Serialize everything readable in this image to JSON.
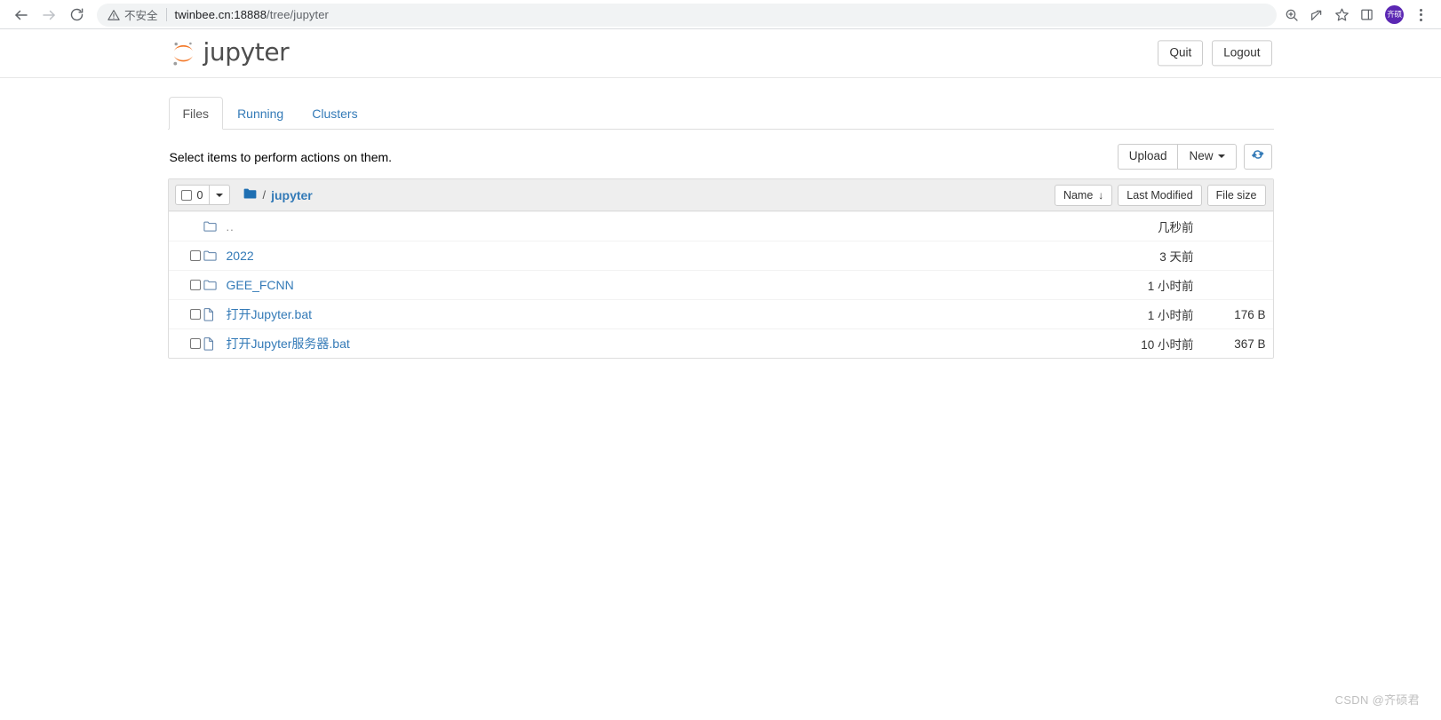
{
  "browser": {
    "back_icon": "back-arrow-icon",
    "forward_icon": "forward-arrow-icon",
    "reload_icon": "reload-icon",
    "security_label": "不安全",
    "url_host": "twinbee.cn:18888",
    "url_path": "/tree/jupyter",
    "zoom_icon": "zoom-in-icon",
    "share_icon": "share-icon",
    "bookmark_icon": "star-icon",
    "sidepanel_icon": "side-panel-icon",
    "avatar_initials": "齐硕",
    "menu_icon": "kebab-menu-icon"
  },
  "header": {
    "logo_icon": "jupyter-logo-icon",
    "logo_text": "jupyter",
    "quit_label": "Quit",
    "logout_label": "Logout"
  },
  "tabs": [
    {
      "label": "Files",
      "active": true
    },
    {
      "label": "Running",
      "active": false
    },
    {
      "label": "Clusters",
      "active": false
    }
  ],
  "toolbar": {
    "hint": "Select items to perform actions on them.",
    "upload_label": "Upload",
    "new_label": "New",
    "refresh_icon": "refresh-icon"
  },
  "list_header": {
    "selected_count": "0",
    "select_caret_icon": "chevron-down-icon",
    "folder_icon": "folder-filled-icon",
    "path_separator": "/",
    "current_folder": "jupyter",
    "sorters": [
      {
        "label": "Name",
        "arrow": "↓"
      },
      {
        "label": "Last Modified",
        "arrow": ""
      },
      {
        "label": "File size",
        "arrow": ""
      }
    ]
  },
  "rows": [
    {
      "name": "..",
      "type": "folder",
      "icon": "folder-outline-icon",
      "checkbox": false,
      "modified": "几秒前",
      "size": ""
    },
    {
      "name": "2022",
      "type": "folder",
      "icon": "folder-outline-icon",
      "checkbox": true,
      "modified": "3 天前",
      "size": ""
    },
    {
      "name": "GEE_FCNN",
      "type": "folder",
      "icon": "folder-outline-icon",
      "checkbox": true,
      "modified": "1 小时前",
      "size": ""
    },
    {
      "name": "打开Jupyter.bat",
      "type": "file",
      "icon": "file-outline-icon",
      "checkbox": true,
      "modified": "1 小时前",
      "size": "176 B"
    },
    {
      "name": "打开Jupyter服务器.bat",
      "type": "file",
      "icon": "file-outline-icon",
      "checkbox": true,
      "modified": "10 小时前",
      "size": "367 B"
    }
  ],
  "watermark": "CSDN @齐硕君",
  "colors": {
    "link": "#337ab7",
    "logo_orange": "#f37726",
    "avatar_bg": "#5b27b3",
    "header_bg": "#eeeeee"
  }
}
